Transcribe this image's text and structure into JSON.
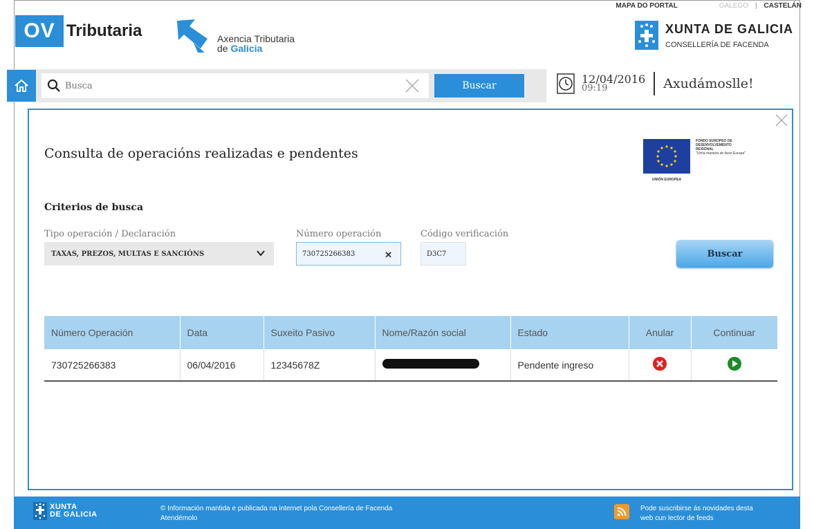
{
  "toplinks": {
    "map": "MAPA DO PORTAL",
    "galego": "GALEGO",
    "sep": "|",
    "castelan": "CASTELÁN"
  },
  "brand": {
    "ov_box": "OV",
    "ov_text": "Tributaria",
    "atg_line1": "Axencia Tributaria",
    "atg_line2a": "de ",
    "atg_line2b": "Galicia",
    "xunta_title": "XUNTA DE GALICIA",
    "xunta_sub": "CONSELLERÍA DE FACENDA"
  },
  "search": {
    "placeholder": "Busca",
    "button": "Buscar"
  },
  "datetime": {
    "date": "12/04/2016",
    "time": "09:19"
  },
  "help": "Axudámoslle!",
  "modal": {
    "title": "Consulta de operacións realizadas e pendentes",
    "eu": {
      "caption": "UNIÓN EUROPEA",
      "line1": "FONDO EUROPEO DE",
      "line2": "DESENVOLVEMENTO",
      "line3": "REXIONAL",
      "slogan": "\"Unha maneira de facer Europa\""
    },
    "criteria_title": "Criterios de busca",
    "labels": {
      "tipo": "Tipo operación / Declaración",
      "numero": "Número operación",
      "codigo": "Código verificación"
    },
    "tipo_value": "TAXAS, PREZOS, MULTAS E SANCIÓNS",
    "numero_value": "730725266383",
    "codigo_value": "D3C7",
    "buscar": "Buscar"
  },
  "table": {
    "headers": [
      "Número Operación",
      "Data",
      "Suxeito Pasivo",
      "Nome/Razón social",
      "Estado",
      "Anular",
      "Continuar"
    ],
    "rows": [
      {
        "numero": "730725266383",
        "data": "06/04/2016",
        "suxeito": "12345678Z",
        "estado": "Pendente ingreso"
      }
    ]
  },
  "footer": {
    "logo_l1": "XUNTA",
    "logo_l2": "DE GALICIA",
    "info_l1": "© Información mantida e publicada na internet pola Consellería de Facenda",
    "info_l2": "Atendémolo",
    "rss_l1": "Pode suscribirse ás novidades desta",
    "rss_l2": "web cun lector de feeds"
  },
  "colors": {
    "accent": "#2a8fd8",
    "header_row": "#a7d3f1",
    "cancel": "#e02020",
    "continue": "#1e8a2a"
  }
}
